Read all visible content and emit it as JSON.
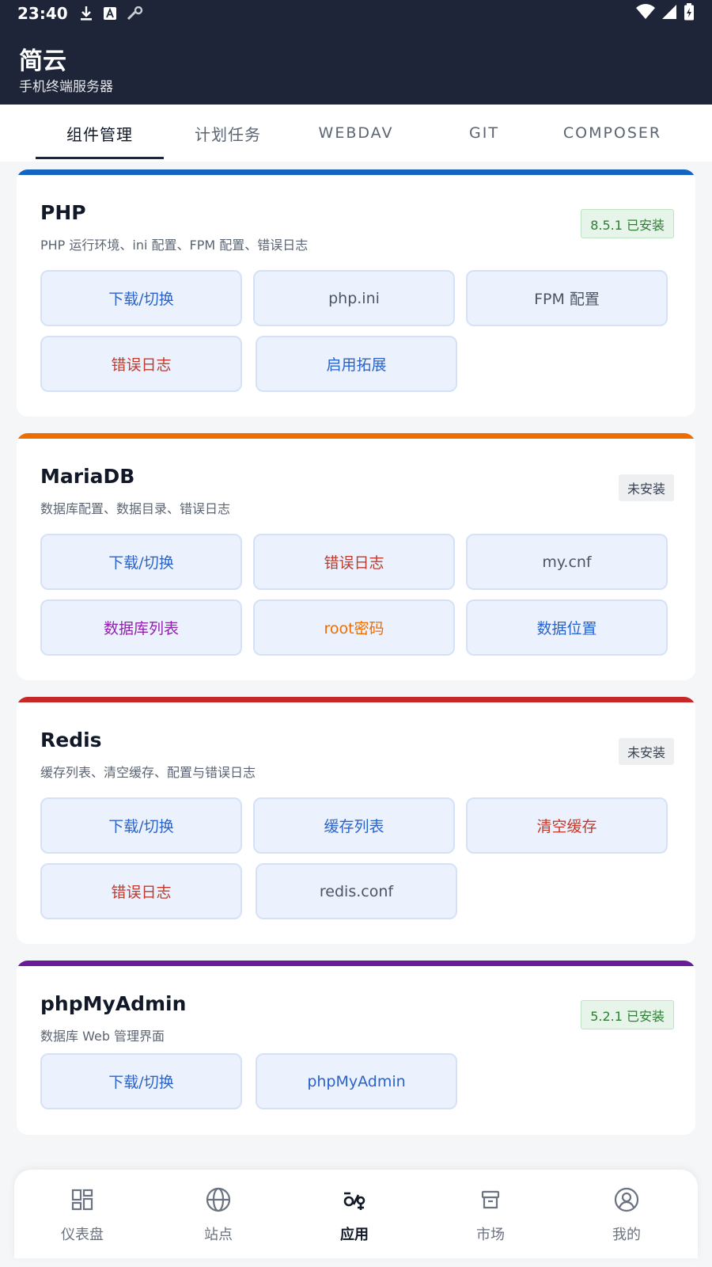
{
  "status_bar": {
    "time": "23:40"
  },
  "app": {
    "title": "简云",
    "subtitle": "手机终端服务器"
  },
  "tabs": [
    {
      "label": "组件管理",
      "active": true
    },
    {
      "label": "计划任务",
      "active": false
    },
    {
      "label": "WEBDAV",
      "active": false
    },
    {
      "label": "GIT",
      "active": false
    },
    {
      "label": "COMPOSER",
      "active": false
    }
  ],
  "components": [
    {
      "name": "PHP",
      "description": "PHP 运行环境、ini 配置、FPM 配置、错误日志",
      "accent": "#1565c0",
      "status": "8.5.1 已安装",
      "installed": true,
      "buttons": [
        {
          "label": "下载/切换",
          "color": "blue"
        },
        {
          "label": "php.ini",
          "color": "gray"
        },
        {
          "label": "FPM 配置",
          "color": "gray"
        },
        {
          "label": "错误日志",
          "color": "red"
        },
        {
          "label": "启用拓展",
          "color": "blue"
        }
      ]
    },
    {
      "name": "MariaDB",
      "description": "数据库配置、数据目录、错误日志",
      "accent": "#ef6c00",
      "status": "未安装",
      "installed": false,
      "buttons": [
        {
          "label": "下载/切换",
          "color": "blue"
        },
        {
          "label": "错误日志",
          "color": "red"
        },
        {
          "label": "my.cnf",
          "color": "gray"
        },
        {
          "label": "数据库列表",
          "color": "purple"
        },
        {
          "label": "root密码",
          "color": "orange"
        },
        {
          "label": "数据位置",
          "color": "blue"
        }
      ]
    },
    {
      "name": "Redis",
      "description": "缓存列表、清空缓存、配置与错误日志",
      "accent": "#c62828",
      "status": "未安装",
      "installed": false,
      "buttons": [
        {
          "label": "下载/切换",
          "color": "blue"
        },
        {
          "label": "缓存列表",
          "color": "blue"
        },
        {
          "label": "清空缓存",
          "color": "red"
        },
        {
          "label": "错误日志",
          "color": "red"
        },
        {
          "label": "redis.conf",
          "color": "gray"
        }
      ]
    },
    {
      "name": "phpMyAdmin",
      "description": "数据库 Web 管理界面",
      "accent": "#6a1b9a",
      "status": "5.2.1 已安装",
      "installed": true,
      "buttons": [
        {
          "label": "下载/切换",
          "color": "blue"
        },
        {
          "label": "phpMyAdmin",
          "color": "blue"
        }
      ]
    }
  ],
  "bottom_nav": [
    {
      "label": "仪表盘",
      "icon": "dashboard-icon",
      "active": false
    },
    {
      "label": "站点",
      "icon": "globe-icon",
      "active": false
    },
    {
      "label": "应用",
      "icon": "apps-icon",
      "active": true
    },
    {
      "label": "市场",
      "icon": "store-icon",
      "active": false
    },
    {
      "label": "我的",
      "icon": "profile-icon",
      "active": false
    }
  ]
}
